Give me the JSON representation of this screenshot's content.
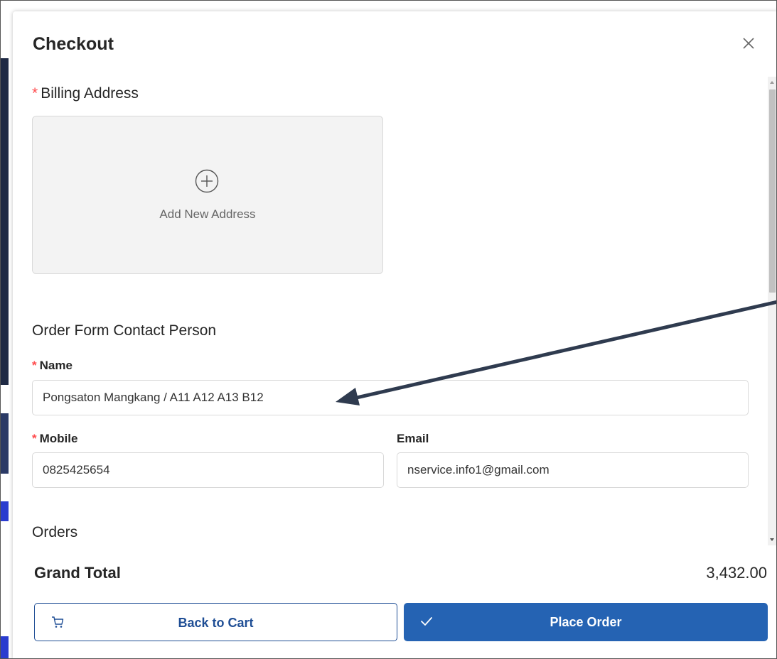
{
  "modal": {
    "title": "Checkout"
  },
  "billing": {
    "required_mark": "*",
    "label": "Billing Address",
    "add_new_label": "Add New Address"
  },
  "contact": {
    "section_label": "Order Form Contact Person",
    "name_label": "Name",
    "name_value": "Pongsaton Mangkang / A11 A12 A13 B12",
    "mobile_label": "Mobile",
    "mobile_value": "0825425654",
    "email_label": "Email",
    "email_value": "nservice.info1@gmail.com"
  },
  "orders": {
    "section_label": "Orders"
  },
  "summary": {
    "grand_total_label": "Grand Total",
    "grand_total_value": "3,432.00"
  },
  "buttons": {
    "back_label": "Back to Cart",
    "place_label": "Place Order"
  },
  "icons": {
    "close": "close-icon",
    "add": "plus-circle-icon",
    "cart": "cart-icon",
    "check": "check-icon"
  },
  "colors": {
    "primary": "#2563b3",
    "required": "#ff4d4f",
    "annotation_arrow": "#2f3b4f"
  }
}
